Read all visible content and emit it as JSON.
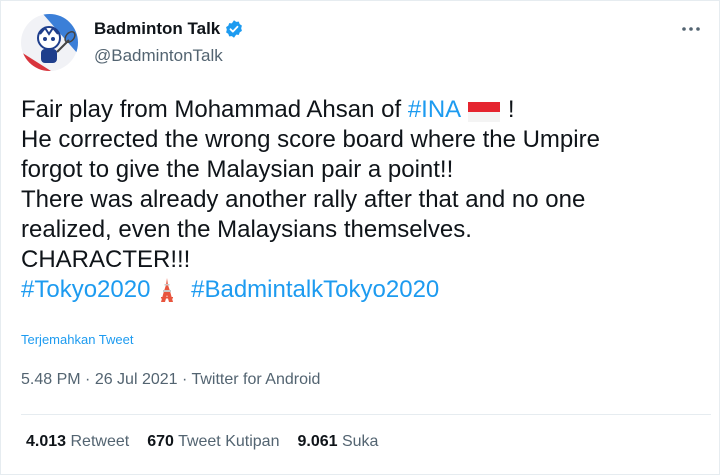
{
  "account": {
    "display_name": "Badminton Talk",
    "handle": "@BadmintonTalk",
    "verified_icon": "verified-badge-icon",
    "avatar": "badminton-mascot-avatar"
  },
  "more_icon": "more-options-icon",
  "tweet": {
    "line1_prefix": "Fair play from Mohammad Ahsan of ",
    "line1_tag": "#INA",
    "line1_flag": "indonesia-flag-emoji",
    "line1_suffix": " !",
    "line2": "He corrected the wrong score board where the Umpire",
    "line3": "forgot to give the Malaysian pair a point!!",
    "line4": "There was already another rally after that and no one",
    "line5": "realized, even the Malaysians themselves.",
    "line6": "CHARACTER!!!",
    "tag_tokyo": "#Tokyo2020",
    "tower_emoji": "tokyo-tower-emoji",
    "tag_badmintalk": "#BadmintalkTokyo2020"
  },
  "translate_label": "Terjemahkan Tweet",
  "meta": {
    "time": "5.48 PM",
    "sep1": " · ",
    "date": "26 Jul 2021",
    "sep2": " · ",
    "source": "Twitter for Android"
  },
  "stats": {
    "retweets_count": "4.013",
    "retweets_label": "Retweet",
    "quotes_count": "670",
    "quotes_label": "Tweet Kutipan",
    "likes_count": "9.061",
    "likes_label": "Suka"
  },
  "colors": {
    "link": "#1d9bf0",
    "text": "#0f1419",
    "secondary": "#536471",
    "border": "#e6ecf0"
  }
}
